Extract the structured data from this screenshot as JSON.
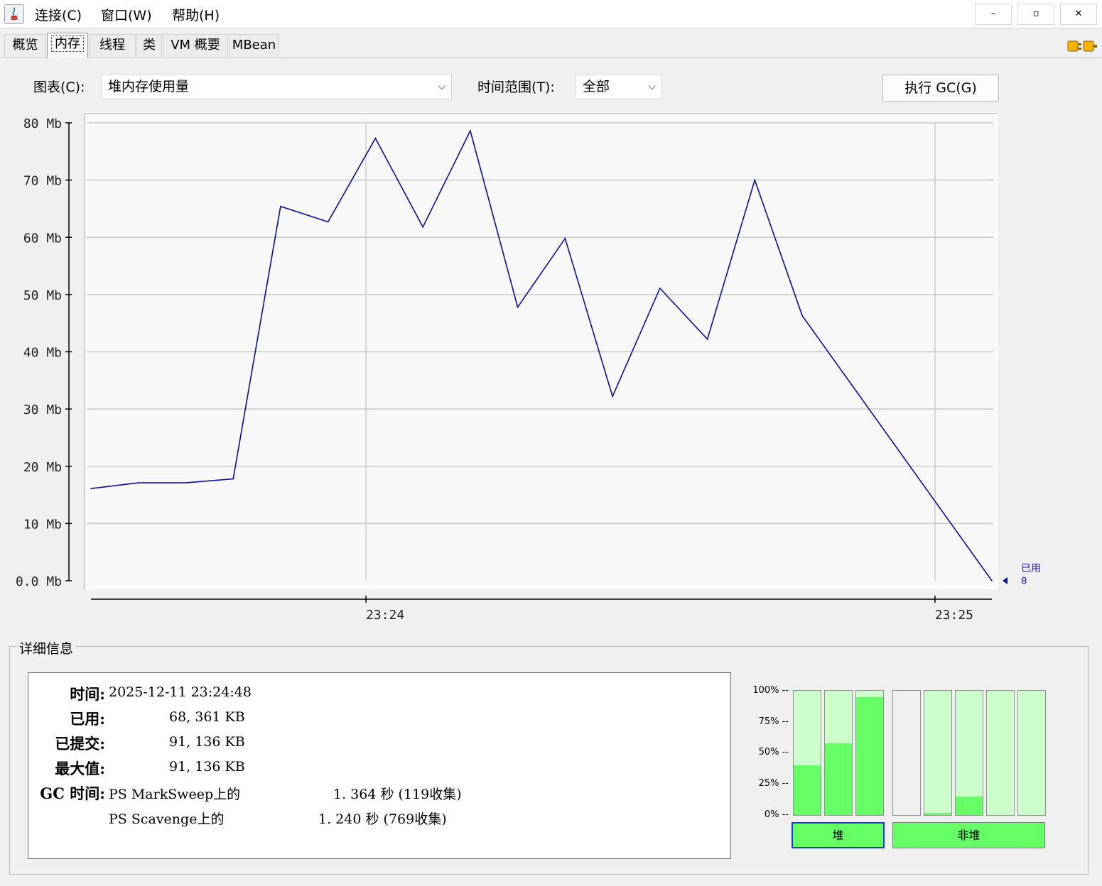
{
  "menu": {
    "connect": "连接(C)",
    "window": "窗口(W)",
    "help": "帮助(H)"
  },
  "window_controls": {
    "minimize": "–",
    "restore": "▫",
    "close": "✕"
  },
  "tabs": [
    {
      "label": "概览"
    },
    {
      "label": "内存",
      "active": true
    },
    {
      "label": "线程"
    },
    {
      "label": "类"
    },
    {
      "label": "VM 概要"
    },
    {
      "label": "MBean"
    }
  ],
  "controls": {
    "chart_label": "图表(C):",
    "chart_value": "堆内存使用量",
    "range_label": "时间范围(T):",
    "range_value": "全部",
    "gc_button": "执行 GC(G)"
  },
  "colors": {
    "series": "#0c0c9c",
    "pool_used": "#66ff66",
    "pool_committed": "#ccffcc",
    "selected_border": "#1a3bd6"
  },
  "chart_data": {
    "type": "line",
    "y_unit": "Mb",
    "ylim": [
      0,
      80
    ],
    "y_ticks": [
      "0.0 Mb",
      "10 Mb",
      "20 Mb",
      "30 Mb",
      "40 Mb",
      "50 Mb",
      "60 Mb",
      "70 Mb",
      "80 Mb"
    ],
    "x_ticks": [
      "23:24",
      "23:25"
    ],
    "grid": true,
    "series": [
      {
        "name": "已用",
        "current_value": "0",
        "points": [
          {
            "t": "23:23:31",
            "v": 16.1
          },
          {
            "t": "23:23:36",
            "v": 17.1
          },
          {
            "t": "23:23:41",
            "v": 17.1
          },
          {
            "t": "23:23:46",
            "v": 17.8
          },
          {
            "t": "23:23:51",
            "v": 65.4
          },
          {
            "t": "23:23:56",
            "v": 62.7
          },
          {
            "t": "23:24:01",
            "v": 77.3
          },
          {
            "t": "23:24:06",
            "v": 61.8
          },
          {
            "t": "23:24:11",
            "v": 78.6
          },
          {
            "t": "23:24:16",
            "v": 47.8
          },
          {
            "t": "23:24:21",
            "v": 59.8
          },
          {
            "t": "23:24:26",
            "v": 32.2
          },
          {
            "t": "23:24:31",
            "v": 51.1
          },
          {
            "t": "23:24:36",
            "v": 42.2
          },
          {
            "t": "23:24:41",
            "v": 70.0
          },
          {
            "t": "23:24:46",
            "v": 46.3
          },
          {
            "t": "23:25:06",
            "v": 0.0
          }
        ]
      }
    ]
  },
  "details": {
    "title": "详细信息",
    "time_label": "时间:",
    "time_value": "2025-12-11 23:24:48",
    "used_label": "已用:",
    "used_value": "68, 361 KB",
    "committed_label": "已提交:",
    "committed_value": "91, 136 KB",
    "max_label": "最大值:",
    "max_value": "91, 136 KB",
    "gc_label": "GC 时间:",
    "gc1_name": "PS MarkSweep上的",
    "gc1_value": "1. 364  秒 (119收集)",
    "gc2_name": "PS Scavenge上的",
    "gc2_value": "1. 240  秒 (769收集)"
  },
  "pools": {
    "scale": [
      "100% --",
      "75% --",
      "50% --",
      "25% --",
      "0% --"
    ],
    "heap": [
      {
        "used_fraction": 0.4
      },
      {
        "used_fraction": 0.58
      },
      {
        "used_fraction": 0.95
      }
    ],
    "nonheap": [
      {
        "used_fraction": 0.0,
        "empty": true
      },
      {
        "used_fraction": 0.02
      },
      {
        "used_fraction": 0.15
      },
      {
        "used_fraction": 0.0
      },
      {
        "used_fraction": 0.0
      }
    ],
    "heap_button": "堆",
    "nonheap_button": "非堆"
  }
}
